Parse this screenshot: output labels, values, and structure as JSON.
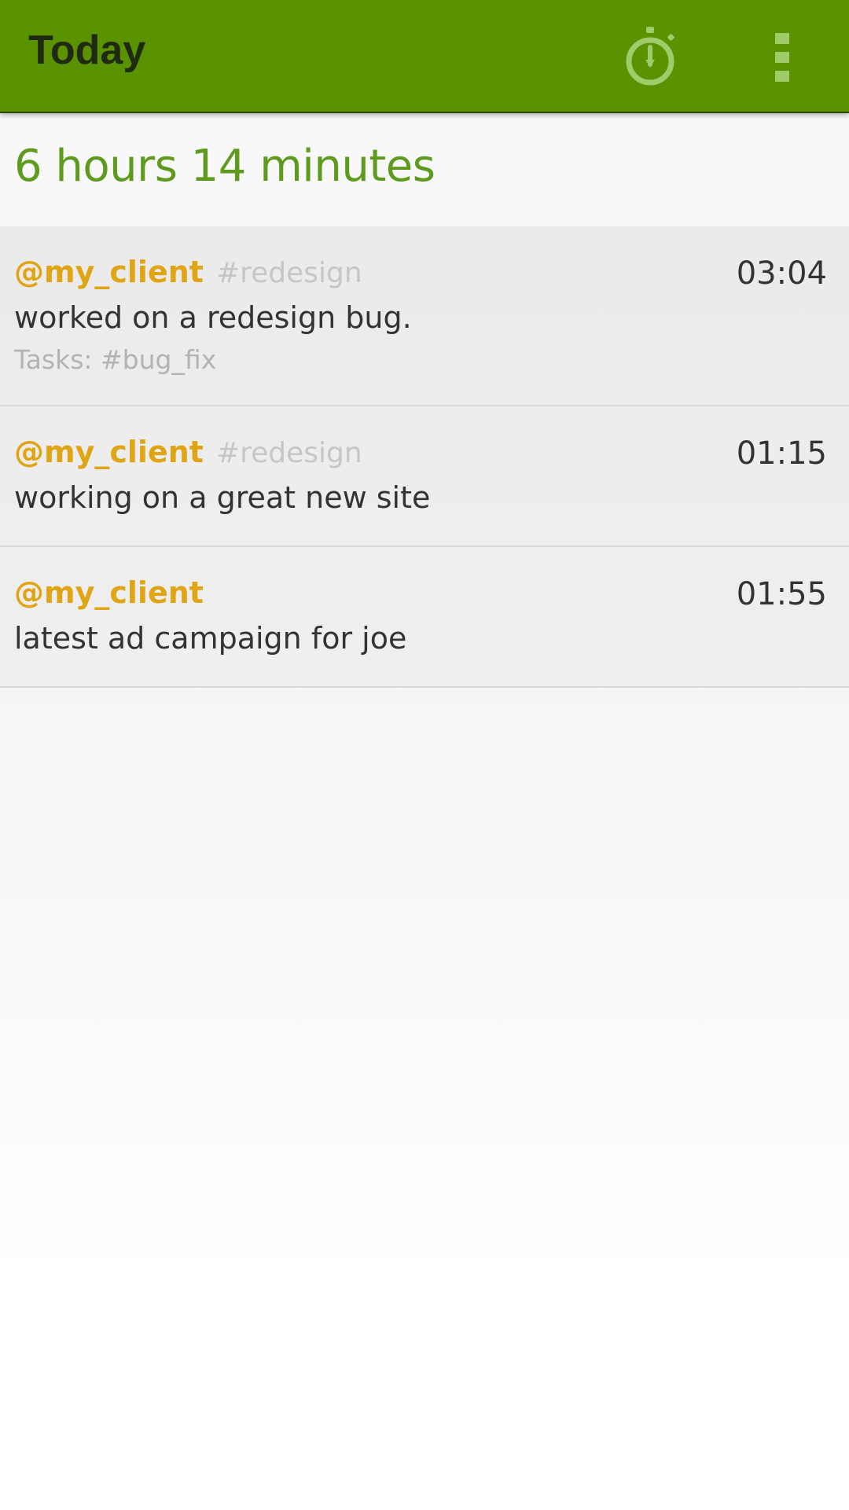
{
  "action_bar": {
    "title": "Today",
    "timer_icon": "stopwatch-icon",
    "menu_icon": "overflow-menu-icon",
    "color": "#5a9200"
  },
  "summary": {
    "total": "6 hours 14 minutes",
    "color": "#5e9a1d"
  },
  "entries": [
    {
      "client": "@my_client",
      "project": "#redesign",
      "description": "worked on a redesign bug.",
      "tasks": "Tasks: #bug_fix",
      "duration": "03:04"
    },
    {
      "client": "@my_client",
      "project": "#redesign",
      "description": "working on a great new site",
      "duration": "01:15"
    },
    {
      "client": "@my_client",
      "description": "latest ad campaign for joe",
      "duration": "01:55"
    }
  ],
  "colors": {
    "client": "#e0a514",
    "project": "#c6c6c6"
  }
}
